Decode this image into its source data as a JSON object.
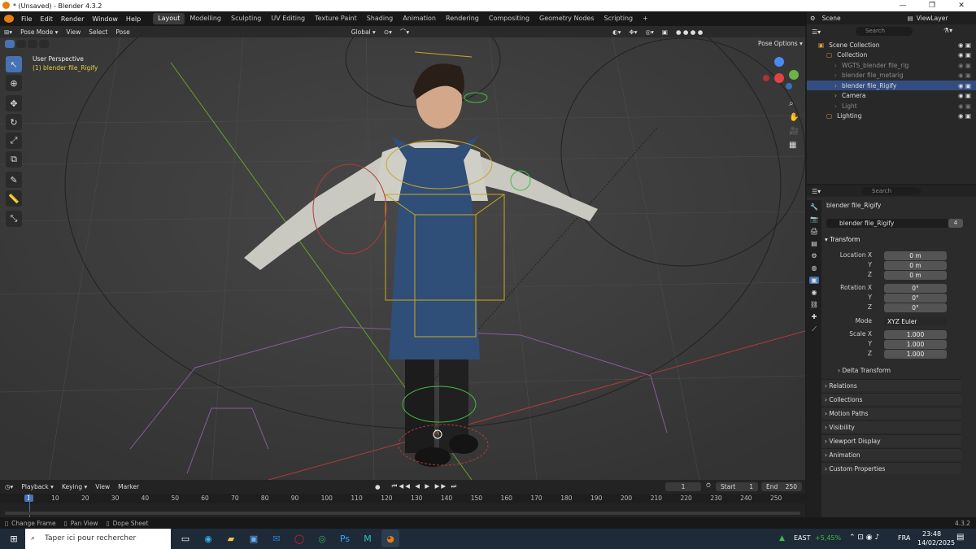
{
  "window": {
    "title": "* (Unsaved) - Blender 4.3.2",
    "minimize": "—",
    "maximize": "❐",
    "close": "✕"
  },
  "menu": [
    "File",
    "Edit",
    "Render",
    "Window",
    "Help"
  ],
  "workspaces": [
    "Layout",
    "Modelling",
    "Sculpting",
    "UV Editing",
    "Texture Paint",
    "Shading",
    "Animation",
    "Rendering",
    "Compositing",
    "Geometry Nodes",
    "Scripting"
  ],
  "top_right": {
    "scene": "Scene",
    "view_layer": "ViewLayer"
  },
  "viewport": {
    "mode": "Pose Mode",
    "header_menus": [
      "View",
      "Select",
      "Pose"
    ],
    "orientation": "Global",
    "pose_options": "Pose Options",
    "overlay_title": "User Perspective",
    "overlay_object": "(1) blender file_Rigify"
  },
  "outliner": {
    "search_placeholder": "Search",
    "rows": [
      {
        "label": "Scene Collection",
        "indent": 0,
        "dim": false,
        "sel": false
      },
      {
        "label": "Collection",
        "indent": 1,
        "dim": false,
        "sel": false
      },
      {
        "label": "WGTS_blender file_rig",
        "indent": 2,
        "dim": true,
        "sel": false
      },
      {
        "label": "blender file_metarig",
        "indent": 2,
        "dim": true,
        "sel": false
      },
      {
        "label": "blender file_Rigify",
        "indent": 2,
        "dim": false,
        "sel": true
      },
      {
        "label": "Camera",
        "indent": 2,
        "dim": false,
        "sel": false
      },
      {
        "label": "Light",
        "indent": 2,
        "dim": true,
        "sel": false
      },
      {
        "label": "Lighting",
        "indent": 1,
        "dim": false,
        "sel": false
      }
    ]
  },
  "properties": {
    "search_placeholder": "Search",
    "object_name": "blender file_Rigify",
    "data_name": "blender file_Rigify",
    "users": "4",
    "transform_label": "Transform",
    "location": {
      "label": "Location X",
      "x": "0 m",
      "y": "0 m",
      "z": "0 m"
    },
    "rotation": {
      "label": "Rotation X",
      "x": "0°",
      "y": "0°",
      "z": "0°"
    },
    "mode_label": "Mode",
    "mode_value": "XYZ Euler",
    "scale": {
      "label": "Scale X",
      "x": "1.000",
      "y": "1.000",
      "z": "1.000"
    },
    "axis_y": "Y",
    "axis_z": "Z",
    "delta": "Delta Transform",
    "sections": [
      "Relations",
      "Collections",
      "Motion Paths",
      "Visibility",
      "Viewport Display",
      "Animation",
      "Custom Properties"
    ]
  },
  "timeline": {
    "menus": [
      "Playback",
      "Keying",
      "View",
      "Marker"
    ],
    "current_frame": "1",
    "start_label": "Start",
    "start": "1",
    "end_label": "End",
    "end": "250",
    "ticks": [
      "1",
      "10",
      "20",
      "30",
      "40",
      "50",
      "60",
      "70",
      "80",
      "90",
      "100",
      "110",
      "120",
      "130",
      "140",
      "150",
      "160",
      "170",
      "180",
      "190",
      "200",
      "210",
      "220",
      "230",
      "240",
      "250"
    ]
  },
  "status": {
    "items": [
      "Change Frame",
      "Pan View",
      "Dope Sheet"
    ],
    "version": "4.3.2"
  },
  "taskbar": {
    "search_placeholder": "Taper ici pour rechercher",
    "market": "EAST",
    "market_change": "+5,45%",
    "lang": "FRA",
    "time": "23:48",
    "date": "14/02/2025"
  }
}
